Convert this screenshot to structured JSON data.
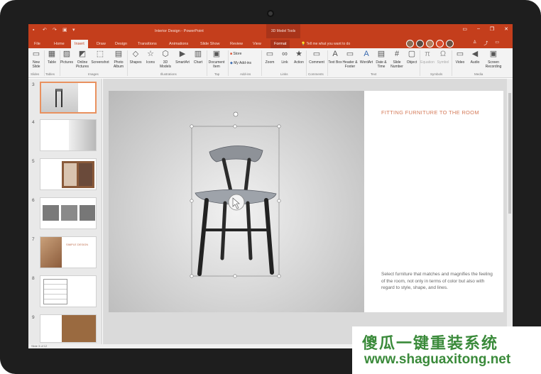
{
  "window": {
    "doc_title": "Interior Design - PowerPoint",
    "context_tools": "3D Model Tools",
    "tell_me": "Tell me what you want to do"
  },
  "tabs": [
    "File",
    "Home",
    "Insert",
    "Draw",
    "Design",
    "Transitions",
    "Animations",
    "Slide Show",
    "Review",
    "View",
    "Format"
  ],
  "active_tab": "Insert",
  "ribbon": {
    "buttons": {
      "new_slide": "New Slide",
      "table": "Table",
      "pictures": "Pictures",
      "online_pictures": "Online Pictures",
      "screenshot": "Screenshot",
      "photo_album": "Photo Album",
      "shapes": "Shapes",
      "icons": "Icons",
      "models_3d": "3D Models",
      "smartart": "SmartArt",
      "chart": "Chart",
      "document_item": "Document Item",
      "store": "Store",
      "my_addins": "My Add-ins",
      "zoom": "Zoom",
      "link": "Link",
      "action": "Action",
      "comment": "Comment",
      "text_box": "Text Box",
      "header_footer": "Header & Footer",
      "wordart": "WordArt",
      "date_time": "Date & Time",
      "slide_number": "Slide Number",
      "object": "Object",
      "equation": "Equation",
      "symbol": "Symbol",
      "video": "Video",
      "audio": "Audio",
      "screen_recording": "Screen Recording"
    },
    "groups": {
      "slides": "Slides",
      "tables": "Tables",
      "images": "Images",
      "illustrations": "Illustrations",
      "tap": "Tap",
      "addins": "Add-ins",
      "links": "Links",
      "comments": "Comments",
      "text": "Text",
      "symbols": "Symbols",
      "media": "Media"
    }
  },
  "thumbnails": {
    "numbers": [
      "3",
      "4",
      "5",
      "6",
      "7",
      "8",
      "9"
    ],
    "selected": "3",
    "slide7_text": "SIMPLE DESIGN"
  },
  "slide": {
    "title": "FITTING FURNITURE TO THE ROOM",
    "body": "Select furniture that matches and magnifies the feeling of the room, not only in terms of color but also with regard to style, shape, and lines."
  },
  "status": {
    "slide_info": "Slide 3 of 12"
  },
  "watermark": {
    "line1": "傻瓜一键重装系统",
    "line2": "www.shaguaxitong.net"
  },
  "colors": {
    "accent": "#c43e1c",
    "title_color": "#d57b5a",
    "watermark": "#3a8a3a"
  }
}
